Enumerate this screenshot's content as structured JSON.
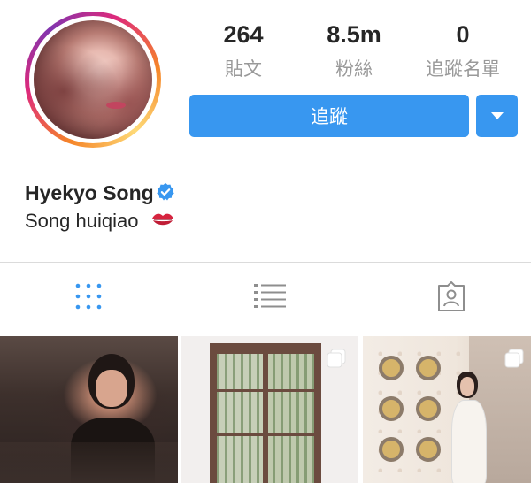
{
  "profile": {
    "username": "Hyekyo Song",
    "bio": "Song huiqiao",
    "verified": true
  },
  "stats": [
    {
      "value": "264",
      "label": "貼文"
    },
    {
      "value": "8.5m",
      "label": "粉絲"
    },
    {
      "value": "0",
      "label": "追蹤名單"
    }
  ],
  "actions": {
    "follow_label": "追蹤"
  },
  "tabs": [
    {
      "icon": "grid-icon",
      "active": true
    },
    {
      "icon": "list-icon",
      "active": false
    },
    {
      "icon": "tagged-icon",
      "active": false
    }
  ],
  "colors": {
    "accent": "#3897f0",
    "muted_text": "#999999",
    "divider": "#dbdbdb"
  }
}
